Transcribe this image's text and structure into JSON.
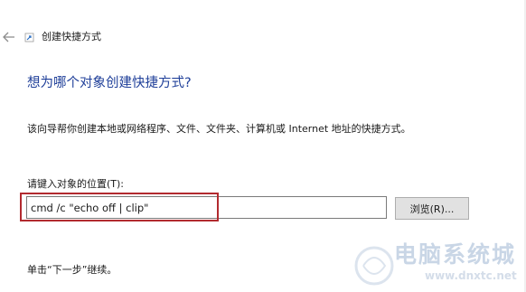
{
  "window": {
    "title": "创建快捷方式",
    "back_icon": "back-arrow-icon",
    "app_icon": "shortcut-wizard-icon"
  },
  "main": {
    "heading": "想为哪个对象创建快捷方式?",
    "description": "该向导帮你创建本地或网络程序、文件、文件夹、计算机或 Internet 地址的快捷方式。",
    "location_label": "请键入对象的位置(T):",
    "location_value": "cmd /c \"echo off | clip\"",
    "browse_label": "浏览(R)...",
    "footer_text": "单击“下一步”继续。"
  },
  "watermark": {
    "text": "电脑系统城",
    "url": "www.dnxtc.net"
  },
  "colors": {
    "heading": "#1f3f99",
    "highlight_border": "#b22a2f",
    "button_bg": "#e1e1e1"
  }
}
